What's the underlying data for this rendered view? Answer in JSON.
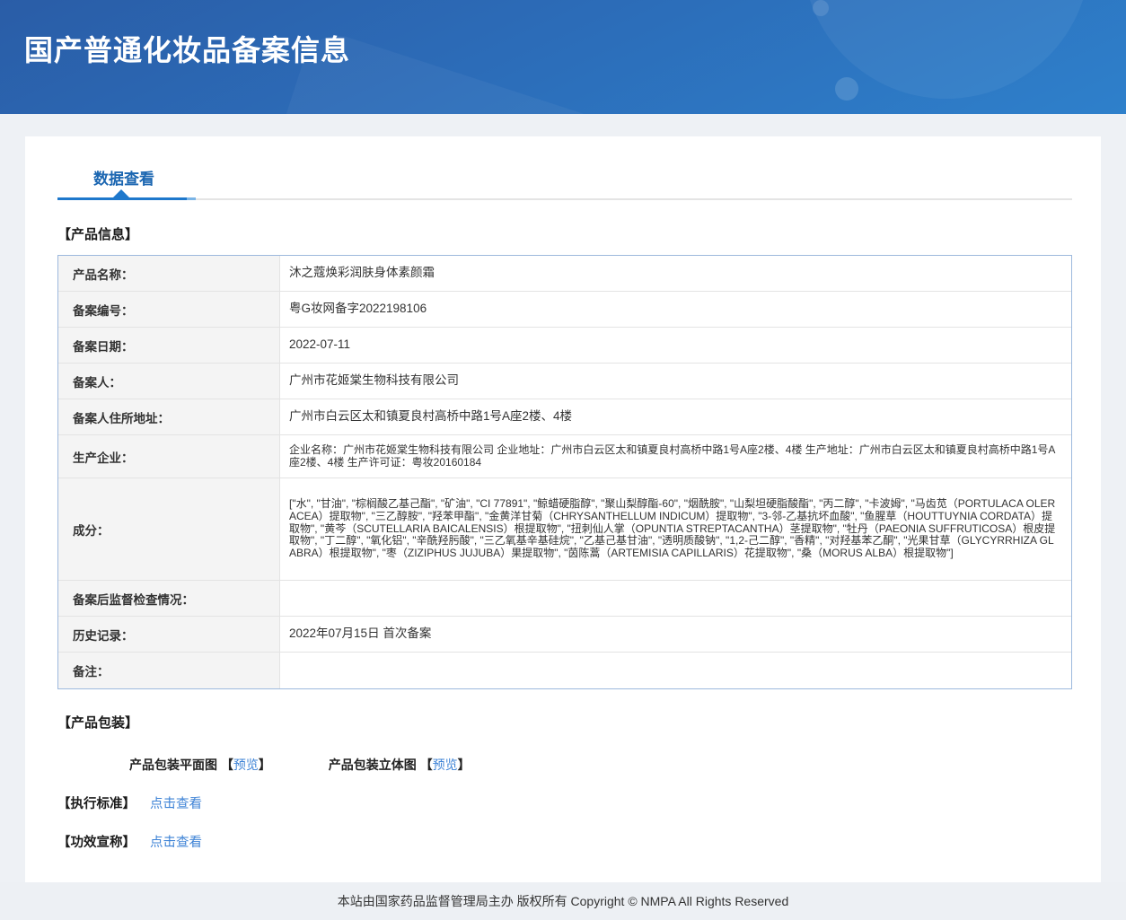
{
  "header": {
    "title": "国产普通化妆品备案信息"
  },
  "tabs": {
    "data_view": "数据查看"
  },
  "sections": {
    "product_info": "【产品信息】",
    "packaging": "【产品包装】",
    "standard": "【执行标准】",
    "efficacy": "【功效宣称】"
  },
  "table": {
    "rows": [
      {
        "label": "产品名称：",
        "value": "沐之蔻焕彩润肤身体素颜霜"
      },
      {
        "label": "备案编号：",
        "value": "粤G妆网备字2022198106"
      },
      {
        "label": "备案日期：",
        "value": "2022-07-11"
      },
      {
        "label": "备案人：",
        "value": "广州市花姬棠生物科技有限公司"
      },
      {
        "label": "备案人住所地址：",
        "value": "广州市白云区太和镇夏良村高桥中路1号A座2楼、4楼"
      },
      {
        "label": "生产企业：",
        "value": "企业名称：广州市花姬棠生物科技有限公司 企业地址：广州市白云区太和镇夏良村高桥中路1号A座2楼、4楼 生产地址：广州市白云区太和镇夏良村高桥中路1号A座2楼、4楼 生产许可证：粤妆20160184"
      },
      {
        "label": "成分：",
        "value": "[\"水\", \"甘油\", \"棕榈酸乙基己酯\", \"矿油\", \"CI 77891\", \"鲸蜡硬脂醇\", \"聚山梨醇酯-60\", \"烟酰胺\", \"山梨坦硬脂酸酯\", \"丙二醇\", \"卡波姆\", \"马齿苋（PORTULACA OLERACEA）提取物\", \"三乙醇胺\", \"羟苯甲酯\", \"金黄洋甘菊（CHRYSANTHELLUM INDICUM）提取物\", \"3-邻-乙基抗坏血酸\", \"鱼腥草（HOUTTUYNIA CORDATA）提取物\", \"黄芩（SCUTELLARIA BAICALENSIS）根提取物\", \"扭刺仙人掌（OPUNTIA STREPTACANTHA）茎提取物\", \"牡丹（PAEONIA SUFFRUTICOSA）根皮提取物\", \"丁二醇\", \"氧化铝\", \"辛酰羟肟酸\", \"三乙氧基辛基硅烷\", \"乙基己基甘油\", \"透明质酸钠\", \"1,2-己二醇\", \"香精\", \"对羟基苯乙酮\", \"光果甘草（GLYCYRRHIZA GLABRA）根提取物\", \"枣（ZIZIPHUS JUJUBA）果提取物\", \"茵陈蒿（ARTEMISIA CAPILLARIS）花提取物\", \"桑（MORUS ALBA）根提取物\"]"
      },
      {
        "label": "备案后监督检查情况：",
        "value": ""
      },
      {
        "label": "历史记录：",
        "value": "2022年07月15日 首次备案"
      },
      {
        "label": "备注：",
        "value": ""
      }
    ]
  },
  "packaging": {
    "flat_label": "产品包装平面图",
    "stereo_label": "产品包装立体图",
    "bracket_open": "【",
    "bracket_close": "】",
    "preview_flat": "预览",
    "preview_stereo": "预览"
  },
  "links": {
    "standard_view": "点击查看",
    "efficacy_view": "点击查看"
  },
  "footer": {
    "copyright": "本站由国家药品监督管理局主办 版权所有 Copyright © NMPA All Rights Reserved"
  },
  "colors": {
    "header_blue_dark": "#2a5da7",
    "header_blue_light": "#2e80cb",
    "tab_blue": "#1b66b1",
    "tab_bar_blue": "#1e78cc",
    "link_blue": "#3e83d6",
    "table_border": "#9db9dd",
    "label_bg": "#f4f4f4",
    "page_bg": "#eef1f5"
  }
}
